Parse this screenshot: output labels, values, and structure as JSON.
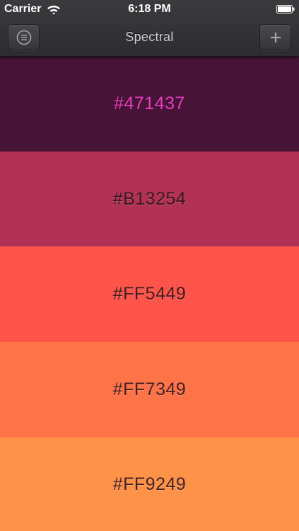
{
  "status_bar": {
    "carrier": "Carrier",
    "time": "6:18 PM"
  },
  "nav": {
    "title": "Spectral",
    "menu_icon": "menu-list-icon",
    "add_icon": "plus-icon"
  },
  "swatches": [
    {
      "hex": "#471437",
      "color": "#471437"
    },
    {
      "hex": "#B13254",
      "color": "#B13254"
    },
    {
      "hex": "#FF5449",
      "color": "#FF5449"
    },
    {
      "hex": "#FF7349",
      "color": "#FF7349"
    },
    {
      "hex": "#FF9249",
      "color": "#FF9249"
    }
  ]
}
